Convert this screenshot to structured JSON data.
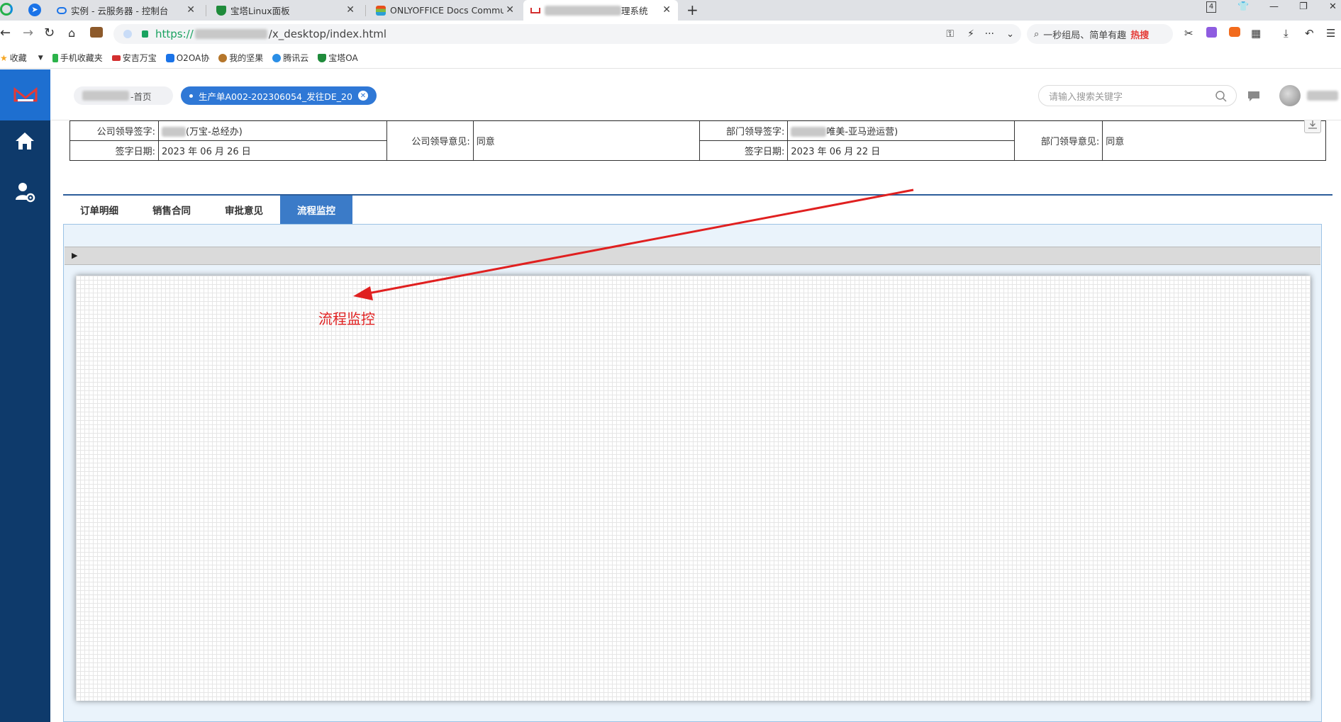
{
  "browser": {
    "tabs": [
      {
        "title": "实例 - 云服务器 - 控制台"
      },
      {
        "title": "宝塔Linux面板"
      },
      {
        "title": "ONLYOFFICE Docs Commun"
      },
      {
        "title": "理系统",
        "active": true
      }
    ],
    "tab_count_badge": "4",
    "url_scheme": "https://",
    "url_path": "/x_desktop/index.html",
    "search_hint": "一秒组局、简单有趣",
    "search_hot": "热搜",
    "bookmarks": [
      "收藏",
      "手机收藏夹",
      "安吉万宝",
      "O2OA协",
      "我的坚果",
      "腾讯云",
      "宝塔OA"
    ]
  },
  "app": {
    "breadcrumb_home": "-首页",
    "breadcrumb_active": "生产单A002-202306054_发往DE_20",
    "search_placeholder": "请输入搜索关键字",
    "sign": {
      "company_leader_label": "公司领导签字:",
      "company_leader_value": "(万宝-总经办)",
      "company_opinion_label": "公司领导意见:",
      "company_opinion_value": "同意",
      "dept_leader_label": "部门领导签字:",
      "dept_leader_value": "唯美-亚马逊运营)",
      "dept_opinion_label": "部门领导意见:",
      "dept_opinion_value": "同意",
      "date_label": "签字日期:",
      "company_date": "2023 年 06 月 26 日",
      "dept_date": "2023 年 06 月 22 日"
    },
    "tabs": [
      "订单明细",
      "销售合同",
      "审批意见",
      "流程监控"
    ],
    "active_tab": "流程监控",
    "annotation": "流程监控"
  },
  "colors": {
    "sidebar": "#0e3a6b",
    "logo_bg": "#1e6fd0",
    "accent": "#2f78d6",
    "annotation": "#e02020"
  }
}
